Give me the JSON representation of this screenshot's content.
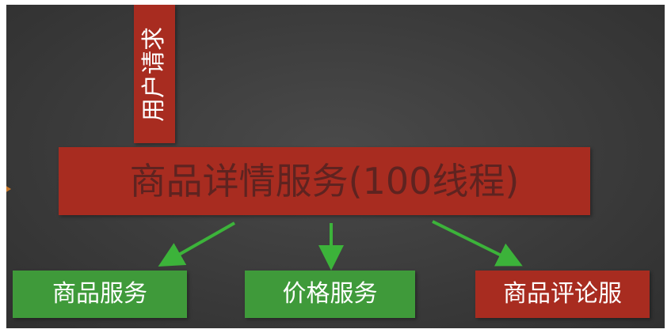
{
  "diagram": {
    "user_request": "用户请求",
    "detail_service": "商品详情服务(100线程)",
    "children": [
      {
        "label": "商品服务",
        "color": "#3f9a3a"
      },
      {
        "label": "价格服务",
        "color": "#3f9a3a"
      },
      {
        "label": "商品评论服",
        "color": "#a82c20"
      }
    ],
    "colors": {
      "background": "#3a3a3a",
      "red": "#a82c20",
      "green": "#3f9a3a",
      "arrow": "#3cb33a"
    }
  }
}
